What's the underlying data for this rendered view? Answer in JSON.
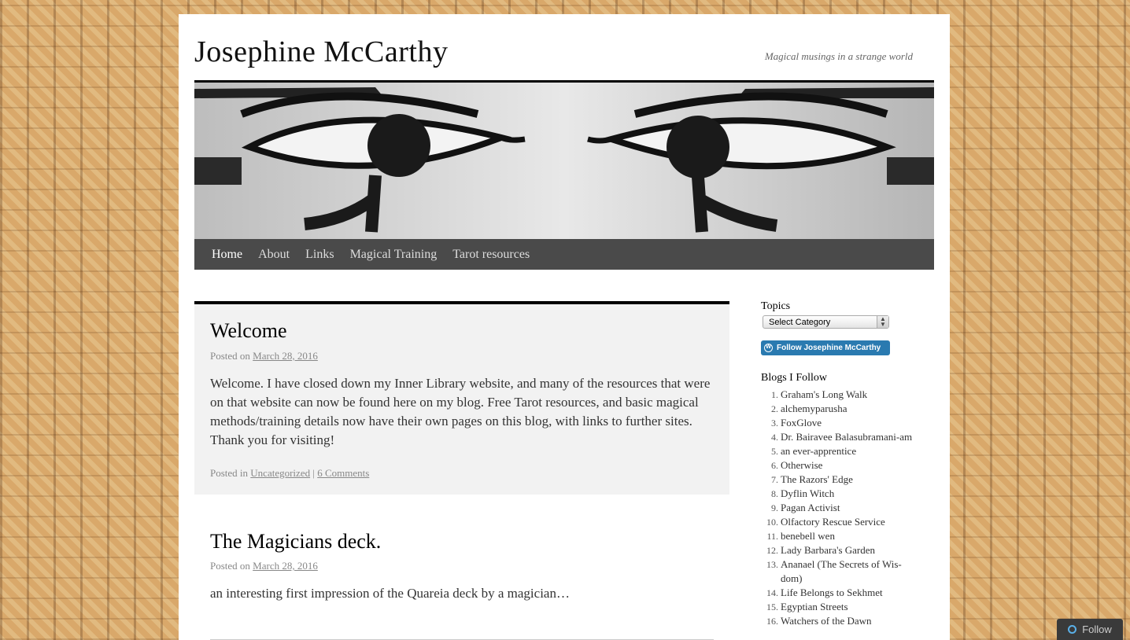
{
  "site": {
    "title": "Josephine McCarthy",
    "tagline": "Magical musings in a strange world"
  },
  "nav": {
    "items": [
      {
        "label": "Home",
        "current": true
      },
      {
        "label": "About"
      },
      {
        "label": "Links"
      },
      {
        "label": "Magical Training"
      },
      {
        "label": "Tarot resources"
      }
    ]
  },
  "posts": [
    {
      "title": "Welcome",
      "posted_on": "Posted on",
      "date": "March 28, 2016",
      "content": "Welcome. I have closed down my Inner Library website, and many of the resources that were on that website can now be found here on my blog. Free Tarot resources, and basic magical methods/training details now have their own pages on this blog, with links to further sites. Thank you for visiting!",
      "posted_in": "Posted in",
      "category": "Uncategorized",
      "separator": "|",
      "comments": "6 Comments"
    },
    {
      "title": "The Magicians deck.",
      "posted_on": "Posted on",
      "date": "March 28, 2016",
      "content": "an interesting first impression of the Quareia deck by a magician…"
    }
  ],
  "sidebar": {
    "topics_title": "Topics",
    "category_select": "Select Category",
    "follow_button": "Follow Josephine McCarthy",
    "blogs_title": "Blogs I Follow",
    "blogs": [
      "Graham's Long Walk",
      "alchemyparusha",
      "FoxGlove",
      "Dr. Bairavee Balasubramani-am",
      "an ever-apprentice",
      "Otherwise",
      "The Razors' Edge",
      "Dyflin Witch",
      "Pagan Activist",
      "Olfactory Rescue Service",
      "benebell wen",
      "Lady Barbara's Garden",
      "Ananael (The Secrets of Wis-dom)",
      "Life Belongs to Sekhmet",
      "Egyptian Streets",
      "Watchers of the Dawn"
    ]
  },
  "follow_bar": {
    "label": "Follow"
  },
  "colors": {
    "nav_bg": "#4a4a4a",
    "follow_button": "#2a7ab0",
    "sticky_bg": "#f2f2f2"
  }
}
